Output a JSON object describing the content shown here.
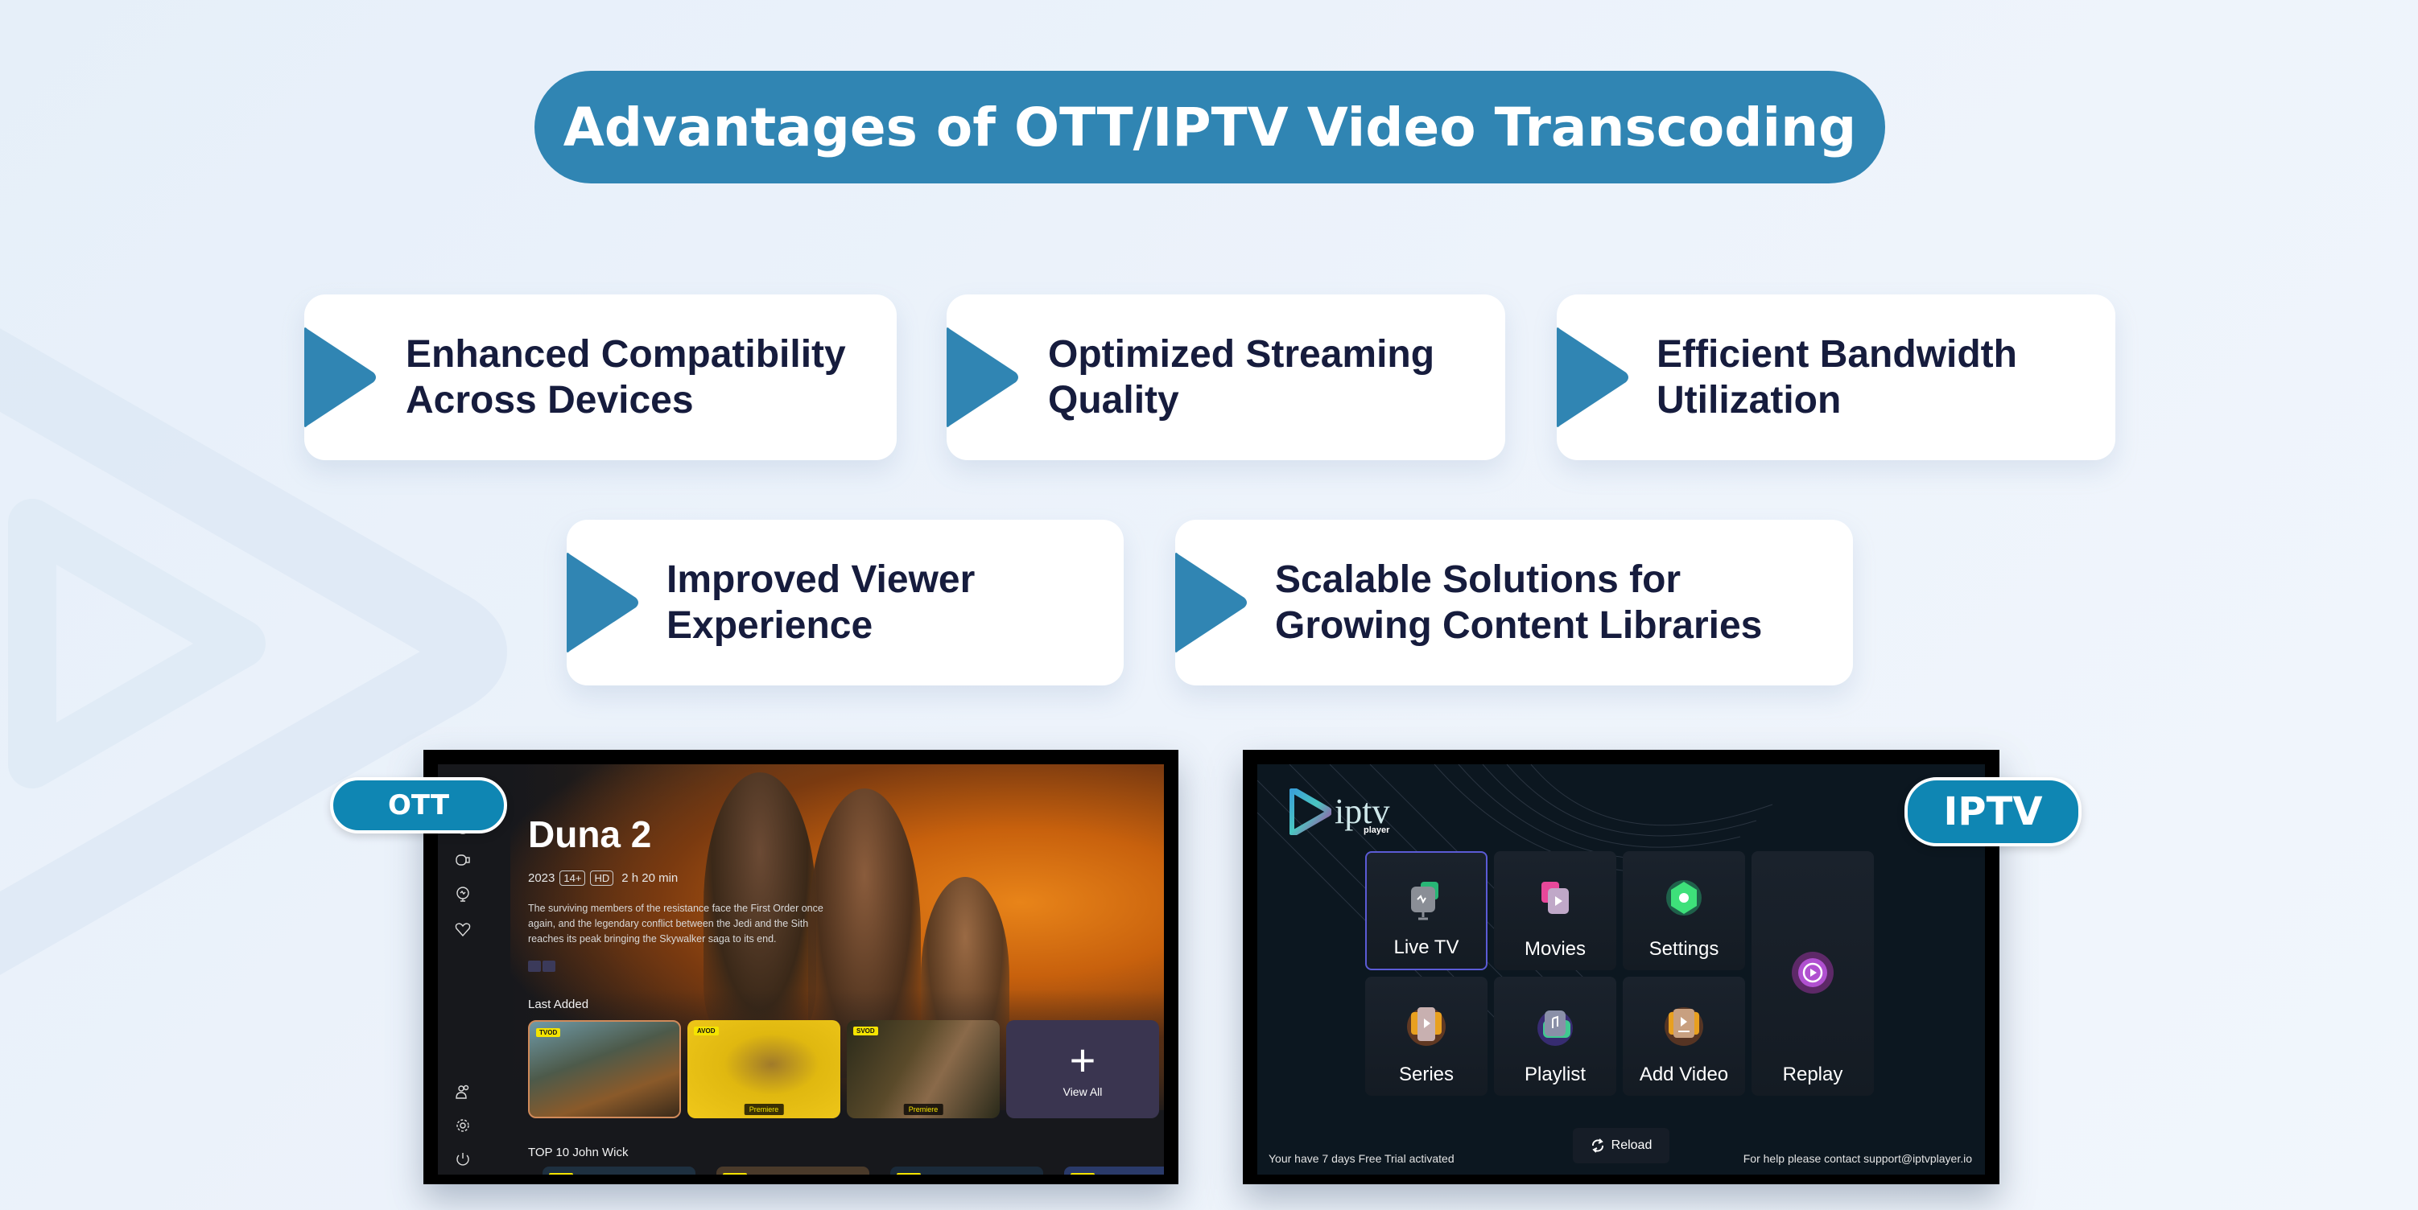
{
  "title": "Advantages of OTT/IPTV Video Transcoding",
  "colors": {
    "accent": "#3085b3",
    "label_pill": "#0f86b3",
    "card_text": "#161c3d",
    "background": "#e9f1fa"
  },
  "advantages": [
    {
      "line1": "Enhanced Compatibility",
      "line2": "Across Devices",
      "icon": "play-arrow-icon"
    },
    {
      "line1": "Optimized Streaming",
      "line2": "Quality",
      "icon": "play-arrow-icon"
    },
    {
      "line1": "Efficient Bandwidth",
      "line2": "Utilization",
      "icon": "play-arrow-icon"
    },
    {
      "line1": "Improved Viewer",
      "line2": "Experience",
      "icon": "play-arrow-icon"
    },
    {
      "line1": "Scalable Solutions for",
      "line2": "Growing Content Libraries",
      "icon": "play-arrow-icon"
    }
  ],
  "ott": {
    "label": "OTT",
    "sidebar_icons": [
      "tv-icon",
      "camera-icon",
      "monitor-icon",
      "heart-icon",
      "users-icon",
      "gear-icon",
      "power-icon"
    ],
    "movie_title": "Duna 2",
    "year": "2023",
    "rating": "14+",
    "quality": "HD",
    "duration": "2 h 20 min",
    "description": "The surviving members of the resistance face the First Order once again, and the legendary conflict between the Jedi and the Sith reaches its peak bringing the Skywalker saga to its end.",
    "section_last_added": "Last Added",
    "last_added": [
      {
        "tag": "TVOD",
        "premiere": ""
      },
      {
        "tag": "AVOD",
        "premiere": "Premiere"
      },
      {
        "tag": "SVOD",
        "premiere": "Premiere"
      }
    ],
    "view_all": "View All",
    "section_top10": "TOP 10 John Wick",
    "top10": [
      {
        "tag": "TVOD"
      },
      {
        "tag": "TVOD"
      },
      {
        "tag": "TVOD"
      },
      {
        "tag": "TVOD"
      }
    ]
  },
  "iptv": {
    "label": "IPTV",
    "logo_main": "iptv",
    "logo_sub": "player",
    "tiles": [
      {
        "label": "Live TV",
        "icon": "live-tv-icon"
      },
      {
        "label": "Movies",
        "icon": "movies-icon"
      },
      {
        "label": "Settings",
        "icon": "settings-icon"
      },
      {
        "label": "Series",
        "icon": "series-icon"
      },
      {
        "label": "Playlist",
        "icon": "playlist-icon"
      },
      {
        "label": "Add Video",
        "icon": "add-video-icon"
      },
      {
        "label": "Replay",
        "icon": "replay-icon"
      }
    ],
    "reload": "Reload",
    "trial_text": "Your have 7 days Free Trial activated",
    "help_text": "For help please contact support@iptvplayer.io"
  }
}
